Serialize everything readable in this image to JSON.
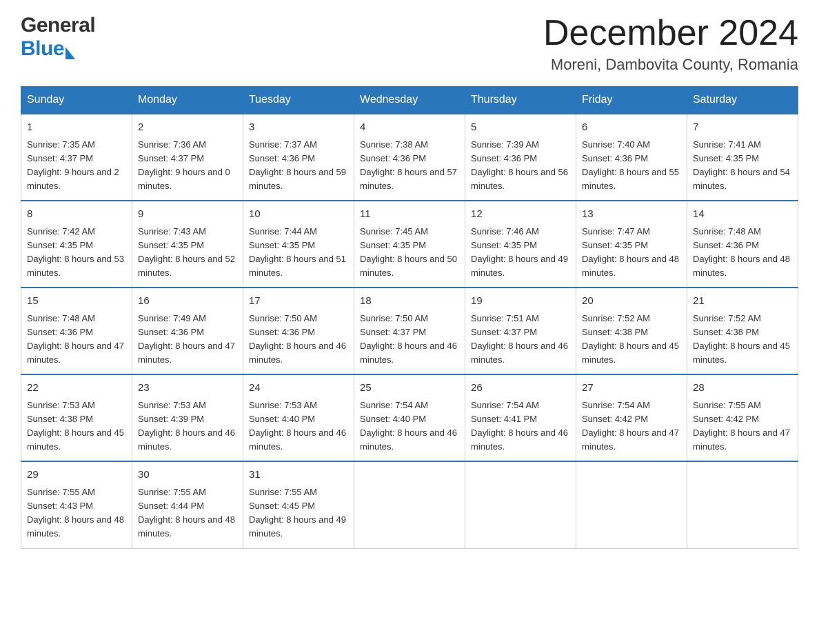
{
  "header": {
    "logo_general": "General",
    "logo_blue": "Blue",
    "month_title": "December 2024",
    "location": "Moreni, Dambovita County, Romania"
  },
  "calendar": {
    "days_of_week": [
      "Sunday",
      "Monday",
      "Tuesday",
      "Wednesday",
      "Thursday",
      "Friday",
      "Saturday"
    ],
    "weeks": [
      [
        {
          "day": "1",
          "sunrise": "7:35 AM",
          "sunset": "4:37 PM",
          "daylight": "9 hours and 2 minutes."
        },
        {
          "day": "2",
          "sunrise": "7:36 AM",
          "sunset": "4:37 PM",
          "daylight": "9 hours and 0 minutes."
        },
        {
          "day": "3",
          "sunrise": "7:37 AM",
          "sunset": "4:36 PM",
          "daylight": "8 hours and 59 minutes."
        },
        {
          "day": "4",
          "sunrise": "7:38 AM",
          "sunset": "4:36 PM",
          "daylight": "8 hours and 57 minutes."
        },
        {
          "day": "5",
          "sunrise": "7:39 AM",
          "sunset": "4:36 PM",
          "daylight": "8 hours and 56 minutes."
        },
        {
          "day": "6",
          "sunrise": "7:40 AM",
          "sunset": "4:36 PM",
          "daylight": "8 hours and 55 minutes."
        },
        {
          "day": "7",
          "sunrise": "7:41 AM",
          "sunset": "4:35 PM",
          "daylight": "8 hours and 54 minutes."
        }
      ],
      [
        {
          "day": "8",
          "sunrise": "7:42 AM",
          "sunset": "4:35 PM",
          "daylight": "8 hours and 53 minutes."
        },
        {
          "day": "9",
          "sunrise": "7:43 AM",
          "sunset": "4:35 PM",
          "daylight": "8 hours and 52 minutes."
        },
        {
          "day": "10",
          "sunrise": "7:44 AM",
          "sunset": "4:35 PM",
          "daylight": "8 hours and 51 minutes."
        },
        {
          "day": "11",
          "sunrise": "7:45 AM",
          "sunset": "4:35 PM",
          "daylight": "8 hours and 50 minutes."
        },
        {
          "day": "12",
          "sunrise": "7:46 AM",
          "sunset": "4:35 PM",
          "daylight": "8 hours and 49 minutes."
        },
        {
          "day": "13",
          "sunrise": "7:47 AM",
          "sunset": "4:35 PM",
          "daylight": "8 hours and 48 minutes."
        },
        {
          "day": "14",
          "sunrise": "7:48 AM",
          "sunset": "4:36 PM",
          "daylight": "8 hours and 48 minutes."
        }
      ],
      [
        {
          "day": "15",
          "sunrise": "7:48 AM",
          "sunset": "4:36 PM",
          "daylight": "8 hours and 47 minutes."
        },
        {
          "day": "16",
          "sunrise": "7:49 AM",
          "sunset": "4:36 PM",
          "daylight": "8 hours and 47 minutes."
        },
        {
          "day": "17",
          "sunrise": "7:50 AM",
          "sunset": "4:36 PM",
          "daylight": "8 hours and 46 minutes."
        },
        {
          "day": "18",
          "sunrise": "7:50 AM",
          "sunset": "4:37 PM",
          "daylight": "8 hours and 46 minutes."
        },
        {
          "day": "19",
          "sunrise": "7:51 AM",
          "sunset": "4:37 PM",
          "daylight": "8 hours and 46 minutes."
        },
        {
          "day": "20",
          "sunrise": "7:52 AM",
          "sunset": "4:38 PM",
          "daylight": "8 hours and 45 minutes."
        },
        {
          "day": "21",
          "sunrise": "7:52 AM",
          "sunset": "4:38 PM",
          "daylight": "8 hours and 45 minutes."
        }
      ],
      [
        {
          "day": "22",
          "sunrise": "7:53 AM",
          "sunset": "4:38 PM",
          "daylight": "8 hours and 45 minutes."
        },
        {
          "day": "23",
          "sunrise": "7:53 AM",
          "sunset": "4:39 PM",
          "daylight": "8 hours and 46 minutes."
        },
        {
          "day": "24",
          "sunrise": "7:53 AM",
          "sunset": "4:40 PM",
          "daylight": "8 hours and 46 minutes."
        },
        {
          "day": "25",
          "sunrise": "7:54 AM",
          "sunset": "4:40 PM",
          "daylight": "8 hours and 46 minutes."
        },
        {
          "day": "26",
          "sunrise": "7:54 AM",
          "sunset": "4:41 PM",
          "daylight": "8 hours and 46 minutes."
        },
        {
          "day": "27",
          "sunrise": "7:54 AM",
          "sunset": "4:42 PM",
          "daylight": "8 hours and 47 minutes."
        },
        {
          "day": "28",
          "sunrise": "7:55 AM",
          "sunset": "4:42 PM",
          "daylight": "8 hours and 47 minutes."
        }
      ],
      [
        {
          "day": "29",
          "sunrise": "7:55 AM",
          "sunset": "4:43 PM",
          "daylight": "8 hours and 48 minutes."
        },
        {
          "day": "30",
          "sunrise": "7:55 AM",
          "sunset": "4:44 PM",
          "daylight": "8 hours and 48 minutes."
        },
        {
          "day": "31",
          "sunrise": "7:55 AM",
          "sunset": "4:45 PM",
          "daylight": "8 hours and 49 minutes."
        },
        null,
        null,
        null,
        null
      ]
    ]
  }
}
